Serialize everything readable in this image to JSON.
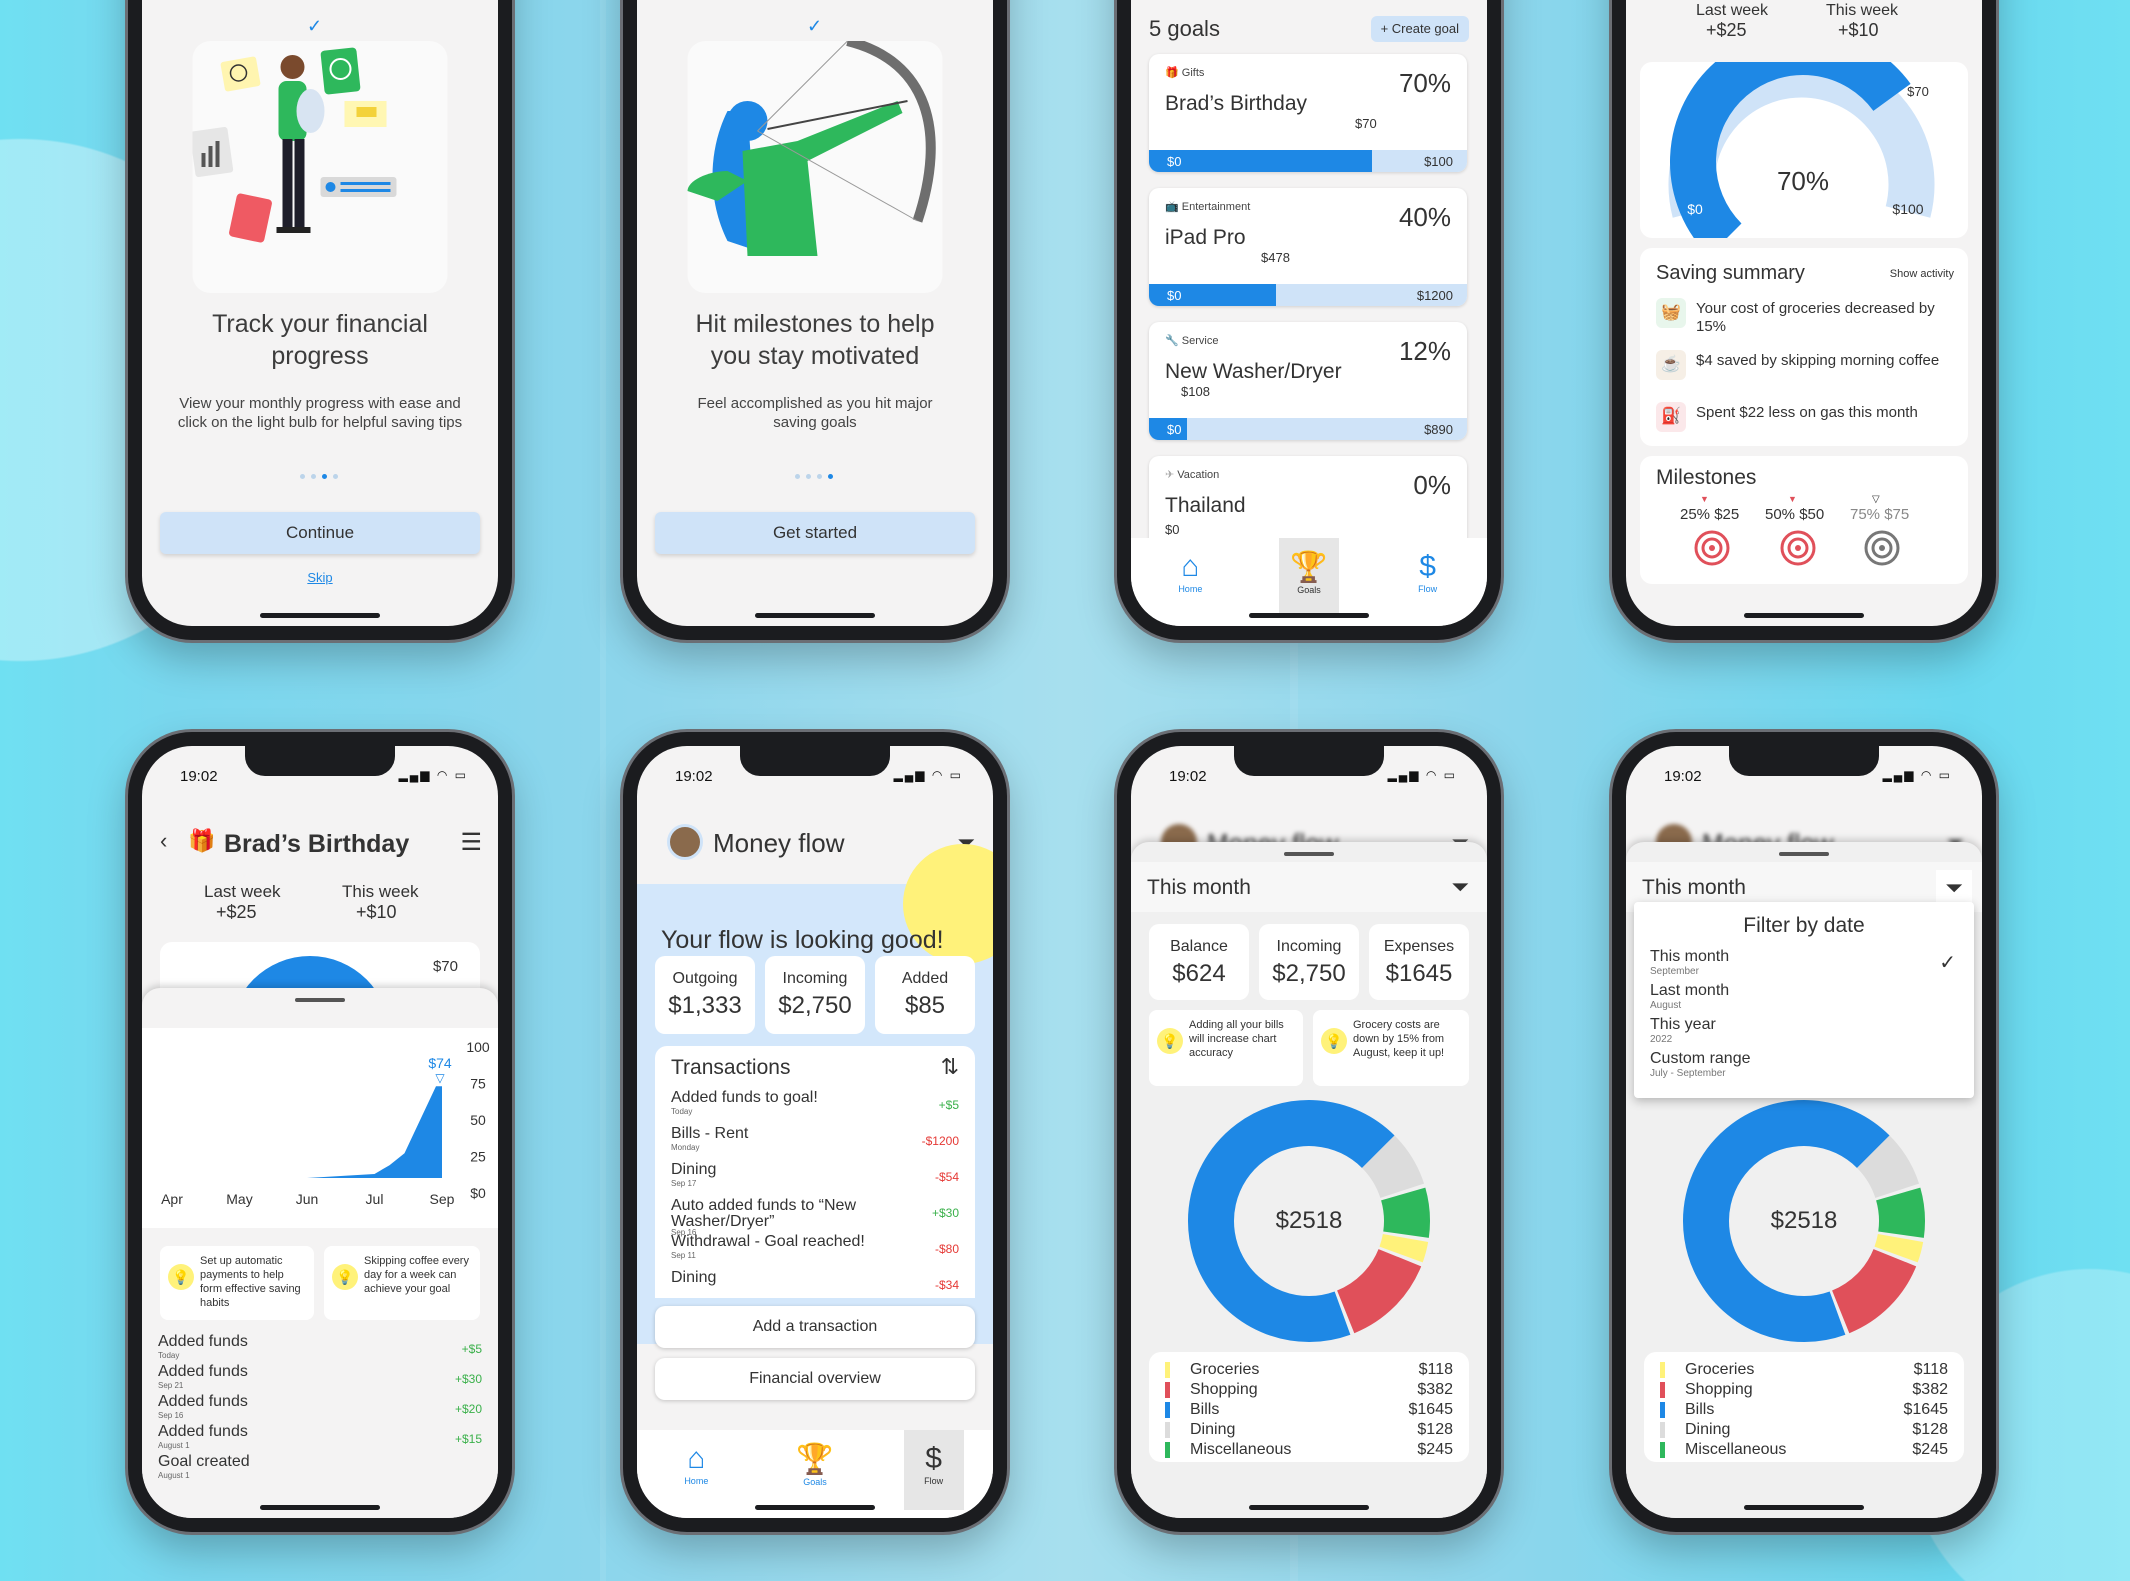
{
  "onboarding1": {
    "title_line1": "Track your financial",
    "title_line2": "progress",
    "text": "View your monthly progress with ease and click on the light bulb for helpful saving tips",
    "primary_button": "Continue",
    "skip_link": "Skip"
  },
  "onboarding2": {
    "title_line1": "Hit milestones to help",
    "title_line2": "you stay motivated",
    "text": "Feel accomplished as you hit major saving goals",
    "primary_button": "Get started"
  },
  "goals_screen": {
    "count_label": "5 goals",
    "create_button": "+ Create goal",
    "goals": [
      {
        "category": "Gifts",
        "name": "Brad’s Birthday",
        "percent": "70%",
        "current": "$70",
        "min": "$0",
        "max": "$100",
        "progress": 0.7
      },
      {
        "category": "Entertainment",
        "name": "iPad Pro",
        "percent": "40%",
        "current": "$478",
        "min": "$0",
        "max": "$1200",
        "progress": 0.4
      },
      {
        "category": "Service",
        "name": "New Washer/Dryer",
        "percent": "12%",
        "current": "$108",
        "min": "$0",
        "max": "$890",
        "progress": 0.12
      },
      {
        "category": "Vacation",
        "name": "Thailand",
        "percent": "0%",
        "current": "$0",
        "min": "$0",
        "max": "",
        "progress": 0
      }
    ],
    "tabs": {
      "home": "Home",
      "goals": "Goals",
      "flow": "Flow"
    }
  },
  "goal_detail_top": {
    "last_week_label": "Last week",
    "last_week_value": "+$25",
    "this_week_label": "This week",
    "this_week_value": "+$10",
    "gauge_center": "70%",
    "gauge_min": "$0",
    "gauge_max": "$100",
    "gauge_marker": "$70",
    "gauge_progress": 0.7,
    "summary_title": "Saving summary",
    "summary_link": "Show activity",
    "summary_items": [
      "Your cost of groceries decreased by 15%",
      "$4 saved by skipping morning coffee",
      "Spent $22 less on gas this month"
    ],
    "milestones_title": "Milestones",
    "milestones": [
      "25% $25",
      "50% $50",
      "75% $75"
    ]
  },
  "status": {
    "time": "19:02",
    "icons": "▂▄▆ ◠ ▭"
  },
  "goal_detail": {
    "title": "Brad’s Birthday",
    "last_week_label": "Last week",
    "last_week_value": "+$25",
    "this_week_label": "This week",
    "this_week_value": "+$10",
    "marker": "$70",
    "chart_marker": "$74",
    "tips": [
      "Set up automatic payments to help form effective saving habits",
      "Skipping coffee every day for a week can achieve your goal"
    ],
    "activity": [
      {
        "name": "Added funds",
        "date": "Today",
        "amount": "+$5"
      },
      {
        "name": "Added funds",
        "date": "Sep 21",
        "amount": "+$30"
      },
      {
        "name": "Added funds",
        "date": "Sep 16",
        "amount": "+$20"
      },
      {
        "name": "Added funds",
        "date": "August 1",
        "amount": "+$15"
      },
      {
        "name": "Goal created",
        "date": "August 1",
        "amount": ""
      }
    ]
  },
  "chart_data": {
    "type": "area",
    "categories": [
      "Apr",
      "May",
      "Jun",
      "Jul",
      "Sep"
    ],
    "y_ticks": [
      "100",
      "75",
      "50",
      "25",
      "$0"
    ],
    "ylim": [
      0,
      100
    ],
    "annotation": "$74",
    "values": [
      0,
      0,
      0,
      20,
      74
    ]
  },
  "money_flow": {
    "title": "Money flow",
    "banner": "Your flow is looking good!",
    "stats": [
      {
        "label": "Outgoing",
        "value": "$1,333"
      },
      {
        "label": "Incoming",
        "value": "$2,750"
      },
      {
        "label": "Added",
        "value": "$85"
      }
    ],
    "transactions_title": "Transactions",
    "transactions": [
      {
        "name": "Added funds to goal!",
        "date": "Today",
        "amount": "+$5",
        "positive": true
      },
      {
        "name": "Bills - Rent",
        "date": "Monday",
        "amount": "-$1200",
        "positive": false
      },
      {
        "name": "Dining",
        "date": "Sep 17",
        "amount": "-$54",
        "positive": false
      },
      {
        "name": "Auto added funds to “New Washer/Dryer”",
        "date": "Sep 16",
        "amount": "+$30",
        "positive": true
      },
      {
        "name": "Withdrawal - Goal reached!",
        "date": "Sep 11",
        "amount": "-$80",
        "positive": false
      },
      {
        "name": "Dining",
        "date": "",
        "amount": "-$34",
        "positive": false
      }
    ],
    "add_button": "Add a transaction",
    "overview_button": "Financial overview",
    "tabs": {
      "home": "Home",
      "goals": "Goals",
      "flow": "Flow"
    }
  },
  "flow_month": {
    "header": "Money flow",
    "period": "This month",
    "stats": [
      {
        "label": "Balance",
        "value": "$624"
      },
      {
        "label": "Incoming",
        "value": "$2,750"
      },
      {
        "label": "Expenses",
        "value": "$1645"
      }
    ],
    "tips": [
      "Adding all your bills will increase chart accuracy",
      "Grocery costs are down by 15% from August, keep it up!"
    ],
    "donut_total": "$2518",
    "legend": [
      {
        "name": "Groceries",
        "value": "$118",
        "color": "#fff27a"
      },
      {
        "name": "Shopping",
        "value": "$382",
        "color": "#e0505a"
      },
      {
        "name": "Bills",
        "value": "$1645",
        "color": "#1e88e5"
      },
      {
        "name": "Dining",
        "value": "$128",
        "color": "#dcdcdc"
      },
      {
        "name": "Miscellaneous",
        "value": "$245",
        "color": "#2eb85c"
      }
    ]
  },
  "flow_filter": {
    "header": "Money flow",
    "period": "This month",
    "filter_title": "Filter by date",
    "options": [
      {
        "label": "This month",
        "sub": "September",
        "checked": "✓"
      },
      {
        "label": "Last month",
        "sub": "August",
        "checked": ""
      },
      {
        "label": "This year",
        "sub": "2022",
        "checked": ""
      },
      {
        "label": "Custom range",
        "sub": "July - September",
        "checked": ""
      }
    ],
    "donut_total": "$2518",
    "legend": [
      {
        "name": "Groceries",
        "value": "$118"
      },
      {
        "name": "Shopping",
        "value": "$382"
      },
      {
        "name": "Bills",
        "value": "$1645"
      },
      {
        "name": "Dining",
        "value": "$128"
      },
      {
        "name": "Miscellaneous",
        "value": "$245"
      }
    ]
  },
  "colors": {
    "accent": "#1e88e5",
    "accent_light": "#cfe3f8",
    "green": "#2eb85c",
    "red": "#e0505a",
    "yellow": "#fff27a"
  }
}
